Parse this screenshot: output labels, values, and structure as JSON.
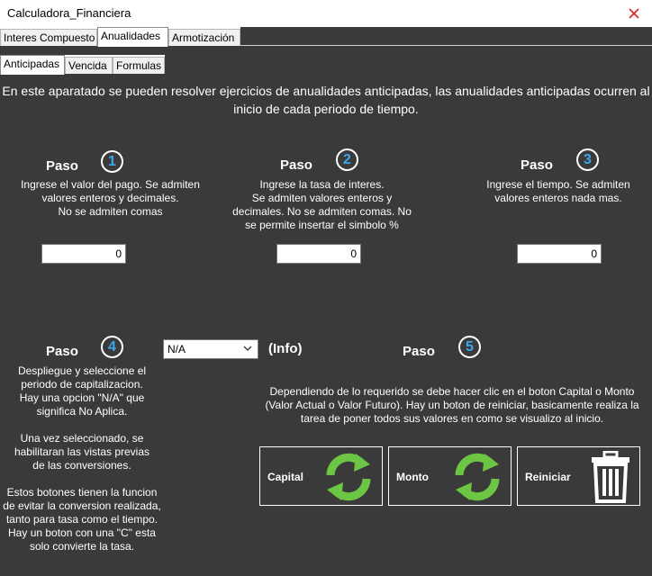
{
  "window": {
    "title": "Calculadora_Financiera"
  },
  "main_tabs": [
    {
      "label": "Interes Compuesto"
    },
    {
      "label": "Anualidades"
    },
    {
      "label": "Armotización"
    }
  ],
  "sub_tabs": [
    {
      "label": "Anticipadas"
    },
    {
      "label": "Vencida"
    },
    {
      "label": "Formulas"
    }
  ],
  "intro": {
    "line1": "En este aparatado se pueden resolver ejercicios de anualidades anticipadas, las anualidades anticipadas ocurren al",
    "line2": "inicio de cada periodo de tiempo."
  },
  "steps": [
    {
      "label": "Paso",
      "number": "1",
      "lines": [
        "Ingrese el valor del pago. Se admiten",
        "valores enteros y decimales.",
        "No se admiten comas"
      ],
      "value": "0"
    },
    {
      "label": "Paso",
      "number": "2",
      "lines": [
        "Ingrese la tasa de interes.",
        "Se admiten valores enteros y",
        "decimales. No se admiten comas. No",
        "se permite insertar el simbolo %"
      ],
      "value": "0"
    },
    {
      "label": "Paso",
      "number": "3",
      "lines": [
        "Ingrese el tiempo. Se admiten",
        "valores enteros nada mas."
      ],
      "value": "0"
    },
    {
      "label": "Paso",
      "number": "4",
      "lines": [
        "Despliegue y seleccione el",
        "periodo de capitalizacion.",
        "Hay una opcion  \"N/A\" que",
        "significa No Aplica.",
        "",
        "Una vez seleccionado, se",
        "habilitaran las vistas previas",
        "de las conversiones.",
        "",
        "Estos botones tienen la funcion",
        "de evitar la conversion realizada,",
        "tanto para tasa como el tiempo.",
        "Hay un boton con una \"C\" esta",
        "solo convierte la tasa."
      ]
    },
    {
      "label": "Paso",
      "number": "5",
      "lines": [
        "Dependiendo de lo requerido se debe hacer clic en el boton Capital o Monto",
        "(Valor Actual o Valor Futuro). Hay un boton de reiniciar, basicamente realiza la",
        "tarea de poner todos sus valores en como se visualizo al inicio."
      ]
    }
  ],
  "period_select": {
    "value": "N/A",
    "info_label": "(Info)"
  },
  "buttons": [
    {
      "label": "Capital",
      "icon": "refresh-icon"
    },
    {
      "label": "Monto",
      "icon": "refresh-icon"
    },
    {
      "label": "Reiniciar",
      "icon": "trash-icon"
    }
  ],
  "colors": {
    "background": "#3a3a3a",
    "accent_number": "#3aa7e8",
    "refresh_green": "#6cc644"
  }
}
